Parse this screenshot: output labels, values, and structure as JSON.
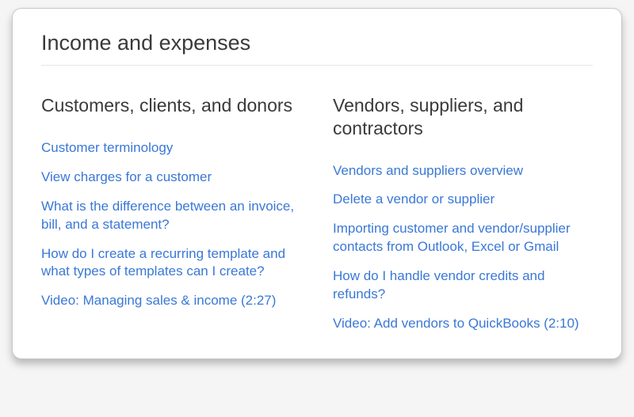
{
  "title": "Income and expenses",
  "columns": [
    {
      "heading": "Customers, clients, and donors",
      "links": [
        "Customer terminology",
        "View charges for a customer",
        "What is the difference between an invoice, bill, and a statement?",
        "How do I create a recurring template and what types of templates can I create?",
        "Video: Managing sales & income (2:27)"
      ]
    },
    {
      "heading": "Vendors, suppliers, and contractors",
      "links": [
        "Vendors and suppliers overview",
        "Delete a vendor or supplier",
        "Importing customer and vendor/supplier contacts from Outlook, Excel or Gmail",
        "How do I handle vendor credits and refunds?",
        "Video: Add vendors to QuickBooks (2:10)"
      ]
    }
  ]
}
